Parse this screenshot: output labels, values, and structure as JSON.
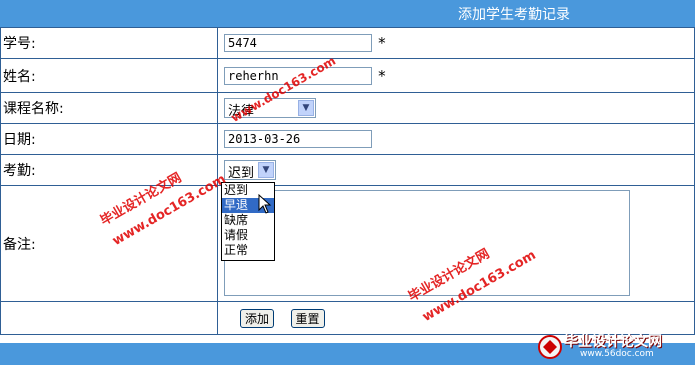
{
  "header": {
    "title": "添加学生考勤记录"
  },
  "form": {
    "student_id": {
      "label": "学号:",
      "value": "5474",
      "required": "*"
    },
    "name": {
      "label": "姓名:",
      "value": "reherhn",
      "required": "*"
    },
    "course": {
      "label": "课程名称:",
      "value": "法律"
    },
    "date": {
      "label": "日期:",
      "value": "2013-03-26"
    },
    "attendance": {
      "label": "考勤:",
      "value": "迟到",
      "options": [
        "迟到",
        "早退",
        "缺席",
        "请假",
        "正常"
      ],
      "highlighted": "早退"
    },
    "remark": {
      "label": "备注:"
    },
    "buttons": {
      "add": "添加",
      "reset": "重置"
    }
  },
  "watermarks": {
    "site_name": "毕业设计论文网",
    "site_url": "www.doc163.com",
    "logo_url": "www.56doc.com"
  },
  "colors": {
    "header_bg": "#4a98dc",
    "border": "#2f5f95",
    "highlight": "#316ac5",
    "watermark": "#e00000"
  }
}
